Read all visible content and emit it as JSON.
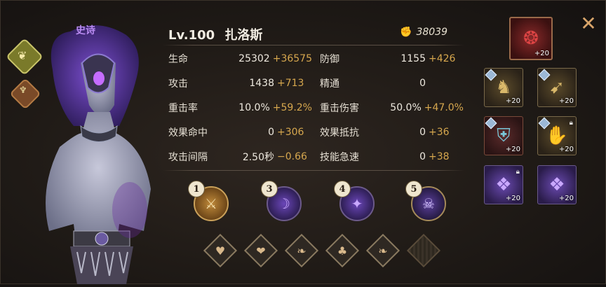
{
  "rarity": "史诗",
  "hero": {
    "level": "Lv.100",
    "name": "扎洛斯",
    "power": "38039",
    "power_icon": "fist-icon"
  },
  "stats_left": [
    {
      "label": "生命",
      "value": "25302",
      "bonus": "+36575"
    },
    {
      "label": "攻击",
      "value": "1438",
      "bonus": "+713"
    },
    {
      "label": "重击率",
      "value": "10.0%",
      "bonus": "+59.2%"
    },
    {
      "label": "效果命中",
      "value": "0",
      "bonus": "+306"
    },
    {
      "label": "攻击间隔",
      "value": "2.50秒",
      "bonus": "−0.66"
    }
  ],
  "stats_right": [
    {
      "label": "防御",
      "value": "1155",
      "bonus": "+426"
    },
    {
      "label": "精通",
      "value": "0",
      "bonus": ""
    },
    {
      "label": "重击伤害",
      "value": "50.0%",
      "bonus": "+47.0%"
    },
    {
      "label": "效果抵抗",
      "value": "0",
      "bonus": "+36"
    },
    {
      "label": "技能急速",
      "value": "0",
      "bonus": "+38"
    }
  ],
  "skills": [
    {
      "num": "1",
      "icon": "crossed-swords-icon"
    },
    {
      "num": "3",
      "icon": "shadow-beast-icon"
    },
    {
      "num": "4",
      "icon": "shadow-flame-icon"
    },
    {
      "num": "5",
      "icon": "demon-face-icon"
    }
  ],
  "runes": [
    {
      "icon": "heart-icon"
    },
    {
      "icon": "heart-hand-icon"
    },
    {
      "icon": "leaf-plus-icon"
    },
    {
      "icon": "gift-bag-icon"
    },
    {
      "icon": "leaf-plus-icon"
    },
    {
      "icon": "empty-slot-icon"
    }
  ],
  "equipment": {
    "main": {
      "icon": "red-mask-icon",
      "level": "+20"
    },
    "slots": [
      {
        "icon": "golden-helm-icon",
        "level": "+20"
      },
      {
        "icon": "golden-bow-icon",
        "level": "+20"
      },
      {
        "icon": "dark-armor-icon",
        "level": "+20"
      },
      {
        "icon": "golden-gauntlet-icon",
        "level": "+20"
      },
      {
        "icon": "purple-crystal-icon",
        "level": "+20"
      },
      {
        "icon": "purple-crystal-icon",
        "level": "+20"
      }
    ]
  },
  "close_icon": "close-icon"
}
